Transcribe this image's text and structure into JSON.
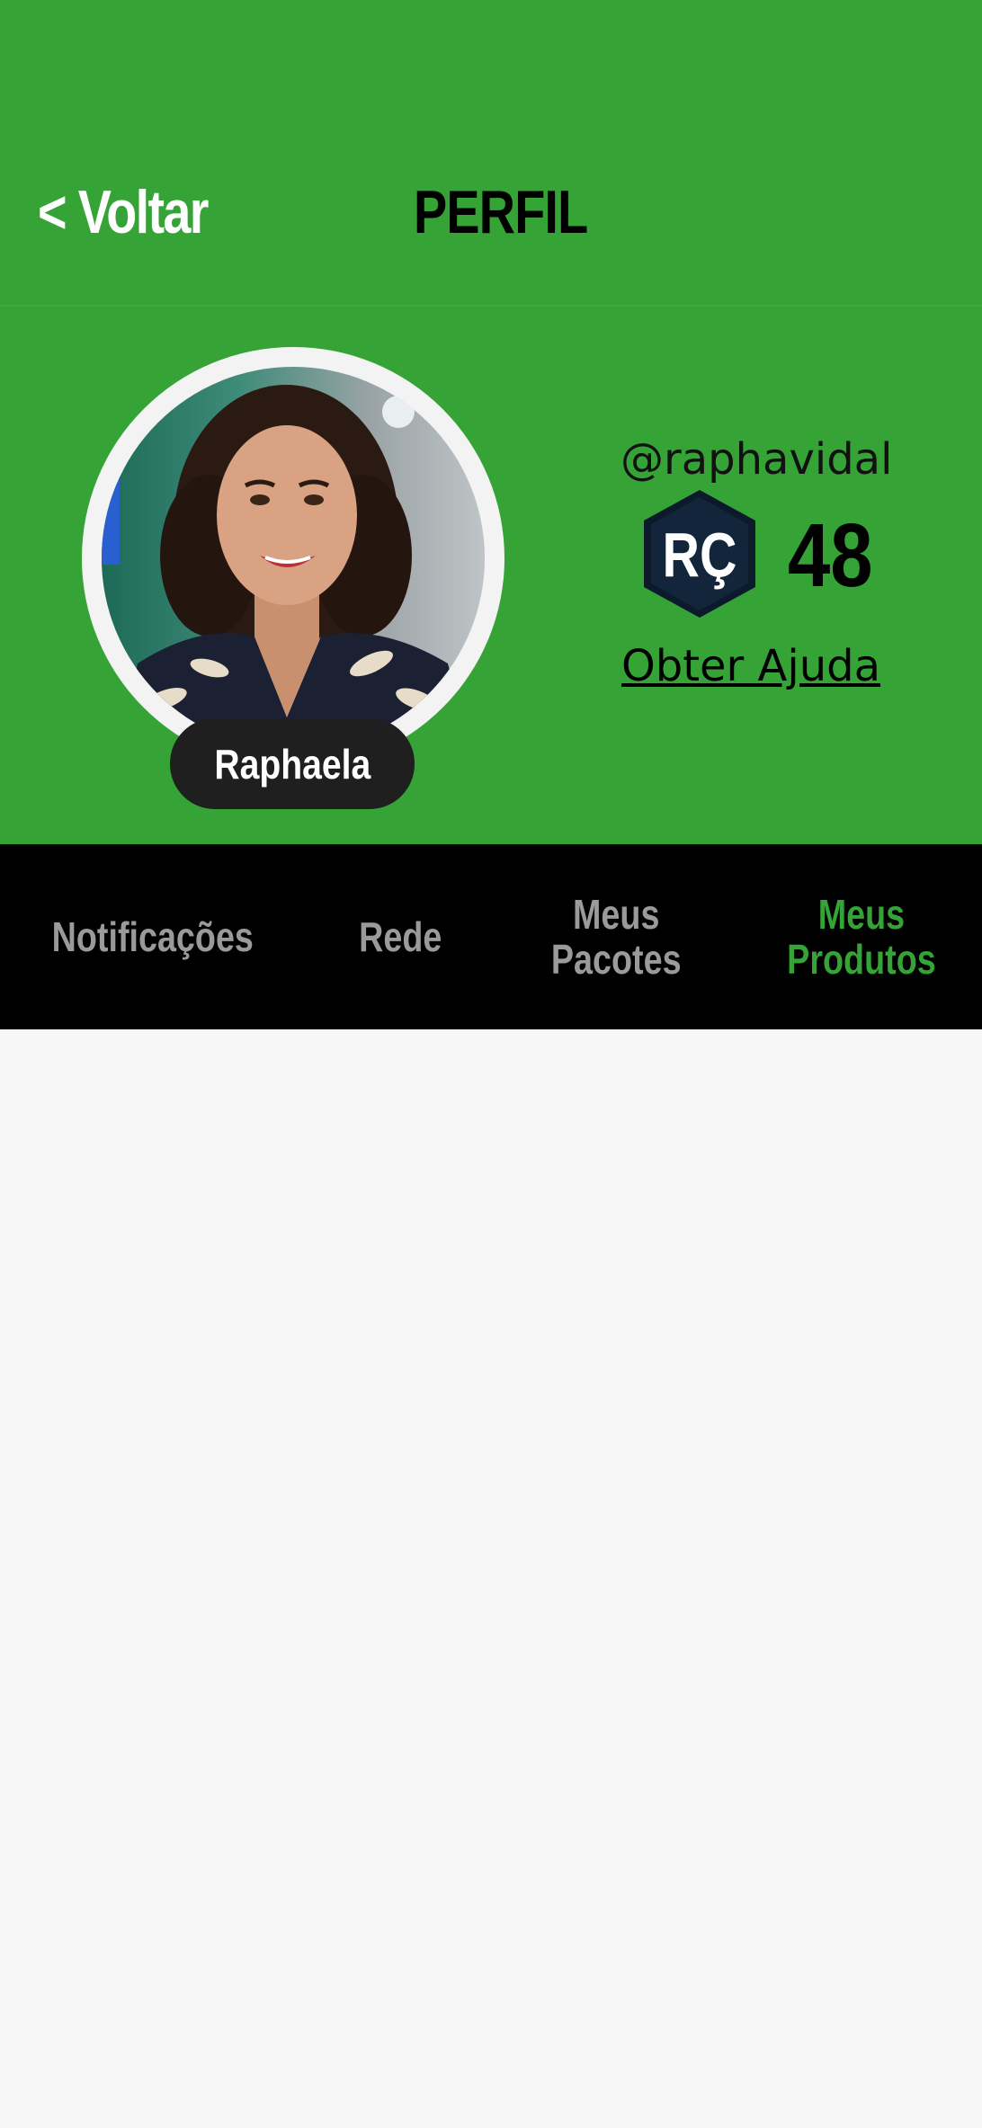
{
  "header": {
    "back_label": "< Voltar",
    "title": "PERFIL"
  },
  "profile": {
    "name": "Raphaela",
    "handle": "@raphavidal",
    "coin_symbol": "RÇ",
    "balance": "48",
    "help_link": "Obter Ajuda"
  },
  "tabs": [
    {
      "label": "Notificações",
      "active": false
    },
    {
      "label": "Rede",
      "active": false
    },
    {
      "label": "Meus\nPacotes",
      "active": false
    },
    {
      "label": "Meus\nProdutos",
      "active": true
    }
  ],
  "colors": {
    "brand_green": "#35a336",
    "tab_bar": "#000000",
    "tab_inactive": "#9a9a9a",
    "tab_active": "#35a336",
    "name_pill": "#1f1f1f",
    "coin_badge": "#0c1a2b",
    "page_background": "#f7f7f7"
  }
}
